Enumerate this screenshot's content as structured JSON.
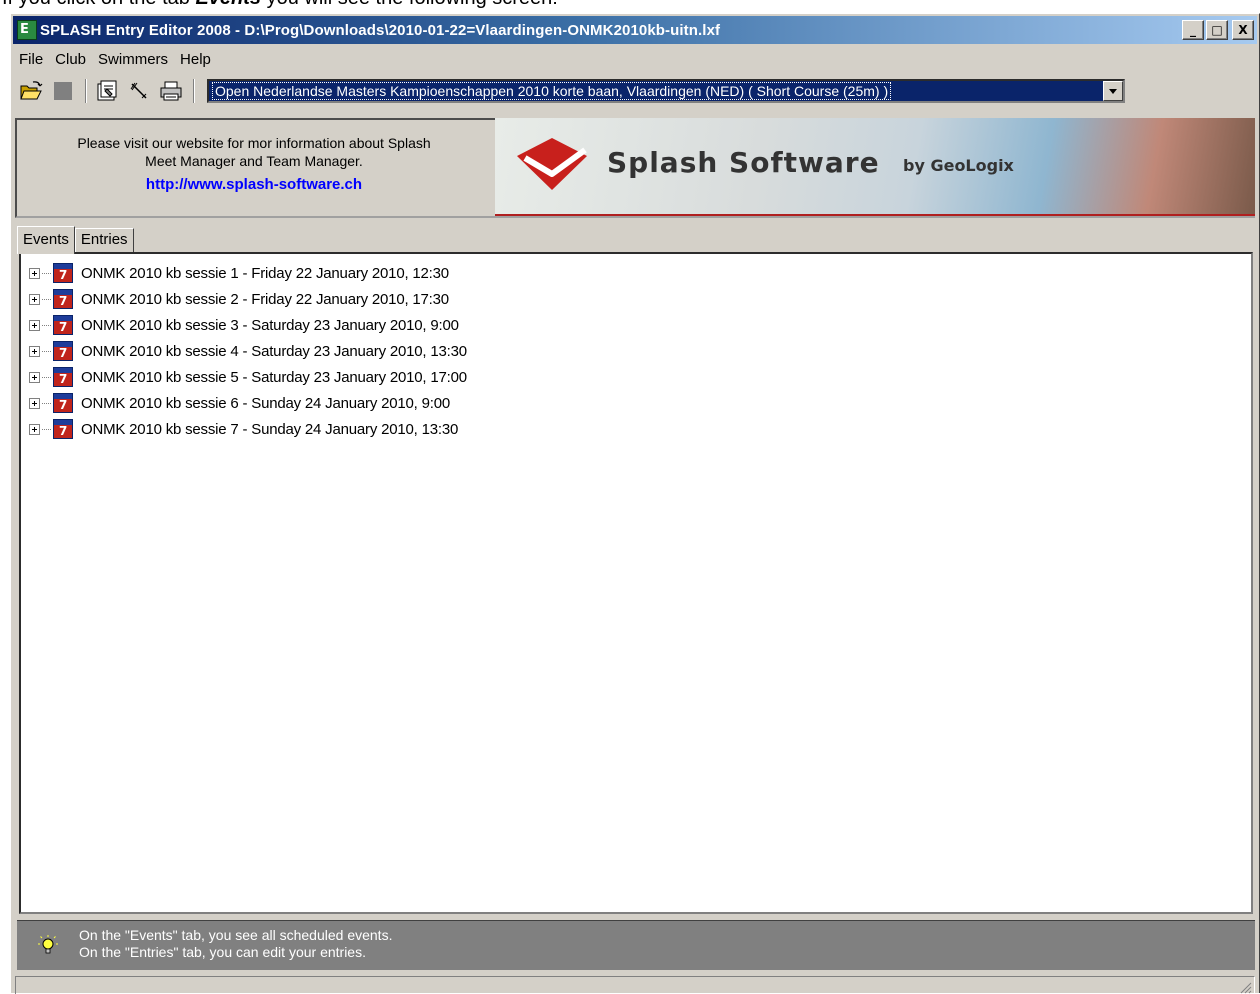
{
  "doc": {
    "heading_before": "If you click on the tab ",
    "heading_em": "Events",
    "heading_after": " you will see the following screen:"
  },
  "window": {
    "title": "SPLASH Entry Editor 2008 - D:\\Prog\\Downloads\\2010-01-22=Vlaardingen-ONMK2010kb-uitn.lxf",
    "minimize": "_",
    "maximize": "□",
    "close": "X"
  },
  "menu": {
    "items": [
      "File",
      "Club",
      "Swimmers",
      "Help"
    ]
  },
  "toolbar": {
    "icons": [
      "open-folder-icon",
      "stop-icon",
      "properties-icon",
      "wand-icon",
      "printer-icon"
    ],
    "meet_selected": "Open Nederlandse Masters Kampioenschappen 2010 korte baan,  Vlaardingen  (NED)   ( Short Course (25m) )"
  },
  "banner": {
    "line1": "Please visit our website for mor information about Splash",
    "line2": "Meet Manager and Team Manager.",
    "link": "http://www.splash-software.ch",
    "logo_text": "Splash Software",
    "logo_by": "by GeoLogix"
  },
  "tabs": [
    {
      "label": "Events",
      "active": true
    },
    {
      "label": "Entries",
      "active": false
    }
  ],
  "sessions": [
    "ONMK 2010 kb sessie 1 - Friday 22 January 2010, 12:30",
    "ONMK 2010 kb sessie 2 - Friday 22 January 2010, 17:30",
    "ONMK 2010 kb sessie 3 - Saturday 23 January 2010, 9:00",
    "ONMK 2010 kb sessie 4 - Saturday 23 January 2010, 13:30",
    "ONMK 2010 kb sessie 5 - Saturday 23 January 2010, 17:00",
    "ONMK 2010 kb sessie 6 - Sunday 24 January 2010, 9:00",
    "ONMK 2010 kb sessie 7 - Sunday 24 January 2010, 13:30"
  ],
  "hint": {
    "line1": "On the \"Events\" tab, you see all scheduled events.",
    "line2": "On the \"Entries\" tab, you can edit your entries."
  },
  "colors": {
    "title_start": "#0a246a",
    "title_end": "#a6caf0",
    "selection": "#0a246a",
    "link": "#0000ff",
    "hint_bg": "#808080"
  }
}
